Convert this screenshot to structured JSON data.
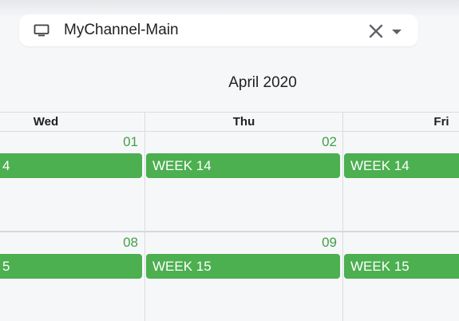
{
  "selector": {
    "value": "MyChannel-Main",
    "icon": "monitor-icon"
  },
  "calendar": {
    "month_title": "April 2020",
    "day_headers": [
      "Wed",
      "Thu",
      "Fri"
    ],
    "weeks": [
      {
        "days": [
          "01",
          "02"
        ],
        "events": [
          "4",
          "WEEK 14",
          "WEEK 14"
        ]
      },
      {
        "days": [
          "08",
          "09"
        ],
        "events": [
          "5",
          "WEEK 15",
          "WEEK 15"
        ]
      }
    ]
  },
  "colors": {
    "event_bg": "#4caf50",
    "day_number": "#43a047",
    "grid": "#dadce0",
    "background": "#f6f7f9"
  }
}
